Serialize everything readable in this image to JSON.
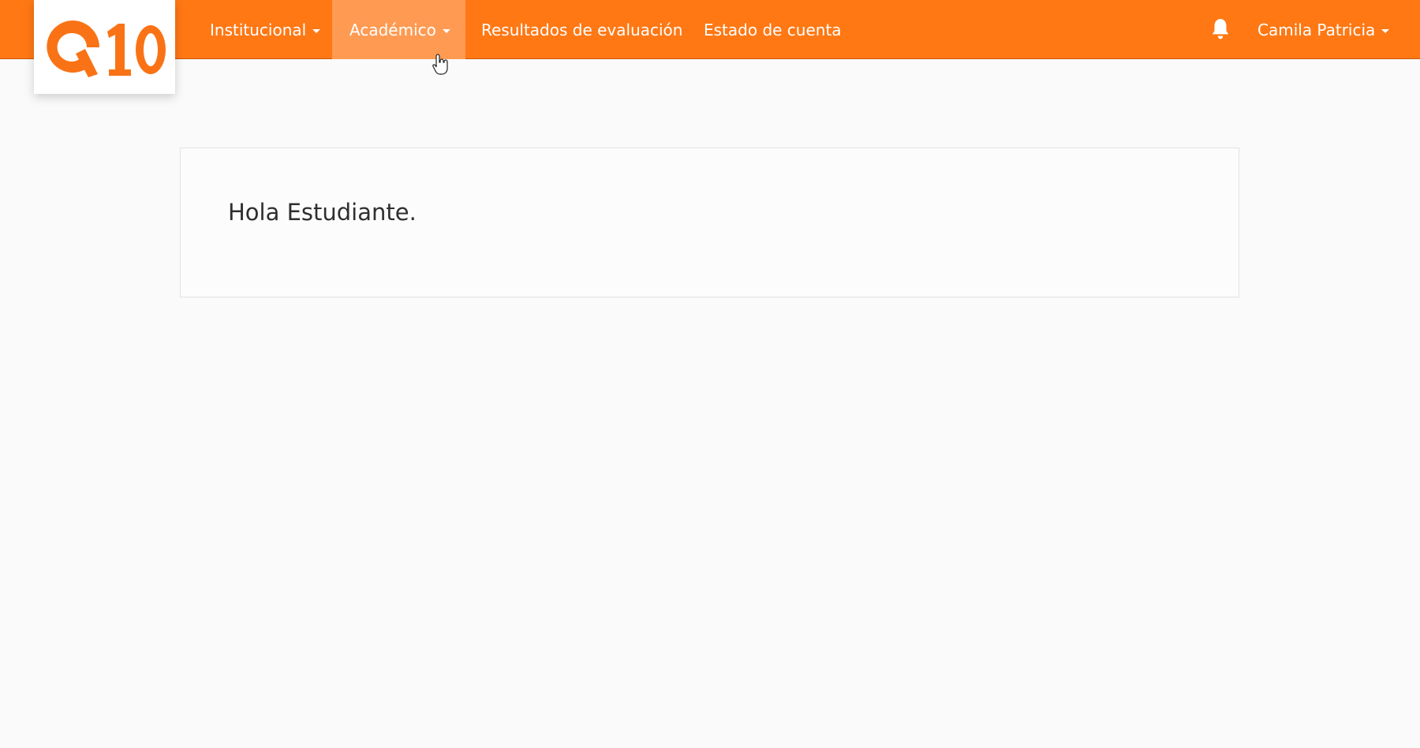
{
  "navbar": {
    "items": [
      {
        "label": "Institucional",
        "dropdown": true
      },
      {
        "label": "Académico",
        "dropdown": true,
        "active": true
      },
      {
        "label": "Resultados de evaluación",
        "dropdown": false
      },
      {
        "label": "Estado de cuenta",
        "dropdown": false
      }
    ],
    "notification_icon": "bell-icon",
    "user": {
      "label": "Camila Patricia",
      "dropdown": true
    }
  },
  "logo": {
    "text": "Q10"
  },
  "main": {
    "greeting": "Hola Estudiante."
  },
  "colors": {
    "navbar_bg": "#ff7814",
    "active_item_bg": "#ff9a52",
    "logo_orange": "#f97316",
    "page_bg": "#fafafa",
    "text_dark": "#2f2f2f"
  }
}
